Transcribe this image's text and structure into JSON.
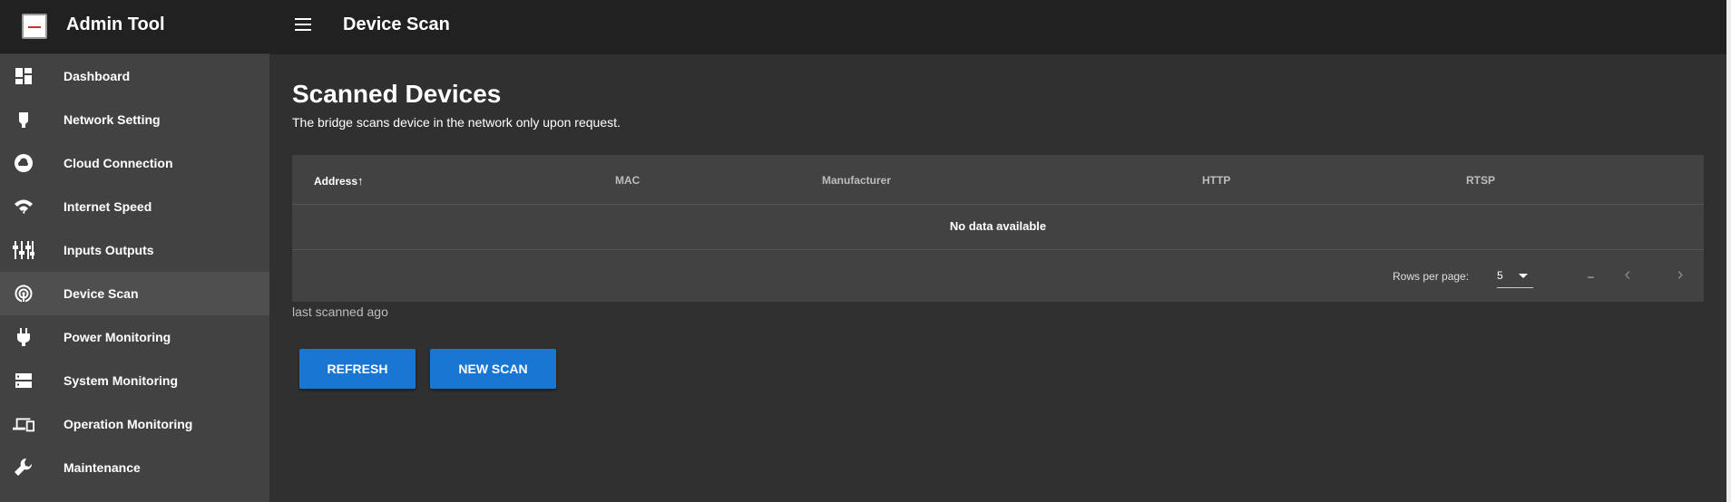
{
  "app": {
    "title": "Admin Tool"
  },
  "header": {
    "title": "Device Scan"
  },
  "sidebar": {
    "items": [
      {
        "label": "Dashboard",
        "icon": "dashboard-icon"
      },
      {
        "label": "Network Setting",
        "icon": "ethernet-icon"
      },
      {
        "label": "Cloud Connection",
        "icon": "cloud-icon"
      },
      {
        "label": "Internet Speed",
        "icon": "wifi-icon"
      },
      {
        "label": "Inputs Outputs",
        "icon": "inputs-outputs-icon"
      },
      {
        "label": "Device Scan",
        "icon": "radar-icon",
        "active": true
      },
      {
        "label": "Power Monitoring",
        "icon": "plug-icon"
      },
      {
        "label": "System Monitoring",
        "icon": "server-icon"
      },
      {
        "label": "Operation Monitoring",
        "icon": "devices-icon"
      },
      {
        "label": "Maintenance",
        "icon": "wrench-icon"
      }
    ]
  },
  "main": {
    "title": "Scanned Devices",
    "subtitle": "The bridge scans device in the network only upon request.",
    "table": {
      "columns": [
        "Address",
        "MAC",
        "Manufacturer",
        "HTTP",
        "RTSP"
      ],
      "sort_indicator": "↑",
      "empty_text": "No data available",
      "rows_per_page_label": "Rows per page:",
      "rows_per_page_value": "5",
      "range_text": "–"
    },
    "last_scanned": "last scanned ago",
    "buttons": {
      "refresh": "REFRESH",
      "new_scan": "NEW SCAN"
    }
  },
  "colors": {
    "accent": "#1976d2",
    "topbar": "#212121",
    "sidebar": "#424242",
    "background": "#303030"
  }
}
